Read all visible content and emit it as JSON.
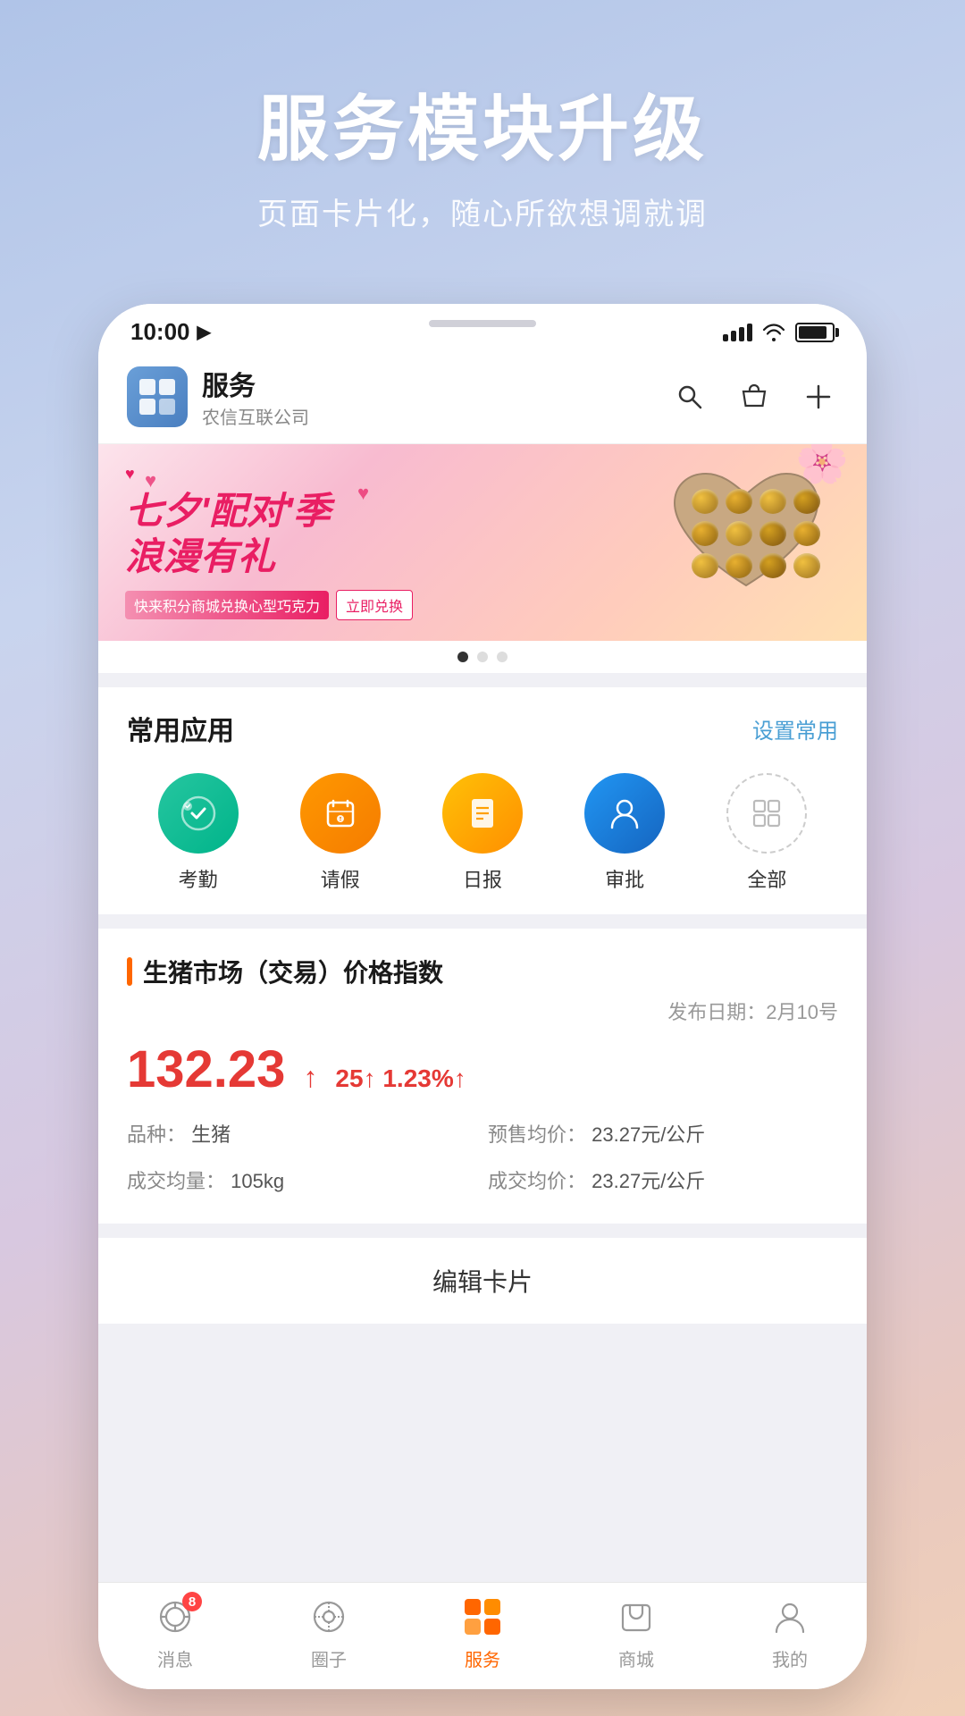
{
  "promo": {
    "title": "服务模块升级",
    "subtitle": "页面卡片化，随心所欲想调就调"
  },
  "statusBar": {
    "time": "10:00",
    "locationIcon": "▶"
  },
  "appHeader": {
    "brandName": "服务",
    "brandSub": "农信互联公司"
  },
  "banner": {
    "line1": "七夕'配对'季",
    "line2": "浪漫有礼",
    "tag": "快来积分商城兑换心型巧克力",
    "cta": "立即兑换",
    "dots": [
      true,
      false,
      false
    ]
  },
  "commonApps": {
    "title": "常用应用",
    "actionLabel": "设置常用",
    "apps": [
      {
        "label": "考勤",
        "iconType": "green",
        "symbol": "🔵"
      },
      {
        "label": "请假",
        "iconType": "orange",
        "symbol": "📋"
      },
      {
        "label": "日报",
        "iconType": "yellow",
        "symbol": "📄"
      },
      {
        "label": "审批",
        "iconType": "blue",
        "symbol": "👤"
      },
      {
        "label": "全部",
        "iconType": "border",
        "symbol": "⊞"
      }
    ]
  },
  "priceIndex": {
    "title": "生猪市场（交易）价格指数",
    "date": "发布日期：2月10号",
    "mainValue": "132.23",
    "changeValue": "25",
    "changePercent": "1.23%",
    "variety": "生猪",
    "volume": "105kg",
    "presalePrice": "23.27元/公斤",
    "tradePrice": "23.27元/公斤",
    "varietyLabel": "品种：",
    "volumeLabel": "成交均量：",
    "presaleLabel": "预售均价：",
    "tradePriceLabel": "成交均价："
  },
  "editCard": {
    "label": "编辑卡片"
  },
  "bottomNav": {
    "items": [
      {
        "label": "消息",
        "badge": "8",
        "active": false
      },
      {
        "label": "圈子",
        "badge": "",
        "active": false
      },
      {
        "label": "服务",
        "badge": "",
        "active": true
      },
      {
        "label": "商城",
        "badge": "",
        "active": false
      },
      {
        "label": "我的",
        "badge": "",
        "active": false
      }
    ]
  }
}
